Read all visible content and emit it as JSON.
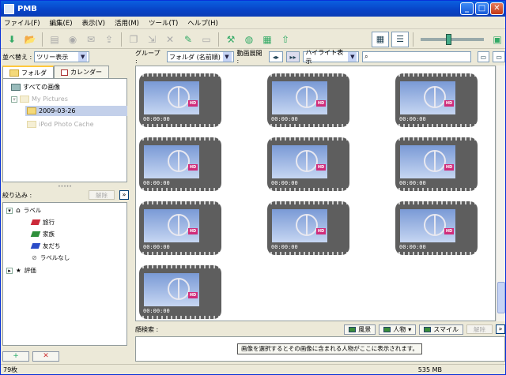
{
  "window": {
    "title": "PMB",
    "minimize": "_",
    "maximize": "□",
    "close": "✕"
  },
  "menu": [
    "ファイル(F)",
    "編集(E)",
    "表示(V)",
    "活用(M)",
    "ツール(T)",
    "ヘルプ(H)"
  ],
  "left": {
    "sort_label": "並べ替え :",
    "sort_value": "ツリー表示",
    "tabs": {
      "folder": "フォルダ",
      "calendar": "カレンダー"
    },
    "tree": {
      "all": "すべての画像",
      "my_pictures": "My Pictures",
      "date": "2009-03-26",
      "ipod": "iPod Photo Cache"
    },
    "filter_label": "絞り込み :",
    "clear_button": "解除",
    "labels": {
      "header": "ラベル",
      "items": [
        "旅行",
        "家族",
        "友だち",
        "ラベルなし"
      ],
      "rating": "評価"
    },
    "tag_colors": [
      "#cc2a3a",
      "#2e8f3a",
      "#2b4cc8",
      "#888888"
    ]
  },
  "right": {
    "group_label": "グループ :",
    "group_value": "フォルダ (名前順)",
    "expand_label": "動画展開 :",
    "highlight_value": "ハイライト表示",
    "thumbs": [
      {
        "time": "00:00:00"
      },
      {
        "time": "00:00:00"
      },
      {
        "time": "00:00:00"
      },
      {
        "time": "00:00:00"
      },
      {
        "time": "00:00:00"
      },
      {
        "time": "00:00:00"
      },
      {
        "time": "00:00:00"
      },
      {
        "time": "00:00:00"
      },
      {
        "time": "00:00:00"
      },
      {
        "time": "00:00:00"
      }
    ],
    "hd_badge": "HD",
    "face": {
      "label": "顔検索 :",
      "landscape": "風景",
      "person": "人物",
      "smile": "スマイル",
      "clear": "解除",
      "hint": "画像を選択するとその画像に含まれる人物がここに表示されます。"
    }
  },
  "status": {
    "count": "79枚",
    "size": "535 MB"
  }
}
